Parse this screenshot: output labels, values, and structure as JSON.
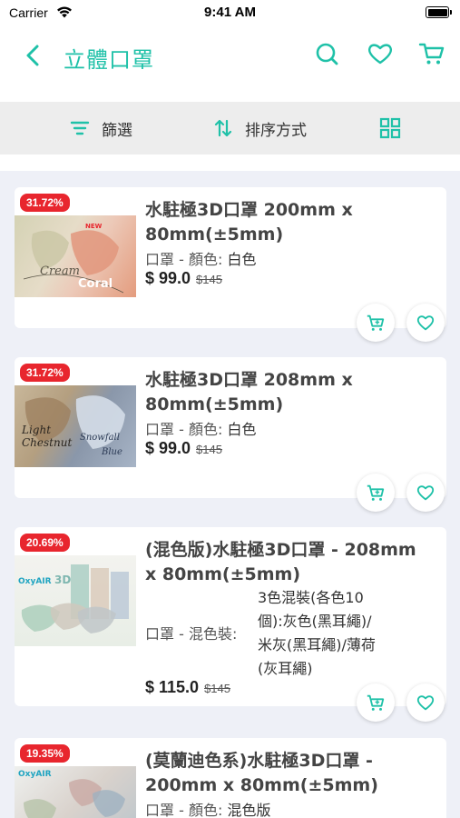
{
  "status_bar": {
    "carrier": "Carrier",
    "time": "9:41 AM"
  },
  "header": {
    "title": "立體口罩",
    "back_icon": "chevron-left-icon",
    "search_icon": "search-icon",
    "wishlist_icon": "heart-icon",
    "cart_icon": "cart-icon"
  },
  "toolbar": {
    "filter_label": "篩選",
    "sort_label": "排序方式",
    "grid_icon": "grid-view-icon"
  },
  "colors": {
    "accent": "#1fc1a8",
    "discount": "#e8262e",
    "list_bg": "#eef0f7",
    "toolbar_bg": "#ededed"
  },
  "products": [
    {
      "discount": "31.72%",
      "title_line1": "水駐極3D口罩 200mm x",
      "title_line2": "80mm(±5mm)",
      "meta_label": "口罩 - 顏色:",
      "meta_value": "白色",
      "price": "$ 99.0",
      "old_price": "$145",
      "image_text_1": "Cream",
      "image_text_2": "Coral",
      "image_text_3": "NEW"
    },
    {
      "discount": "31.72%",
      "title_line1": "水駐極3D口罩 208mm x",
      "title_line2": "80mm(±5mm)",
      "meta_label": "口罩 - 顏色:",
      "meta_value": "白色",
      "price": "$ 99.0",
      "old_price": "$145",
      "image_text_1": "Light",
      "image_text_2": "Chestnut",
      "image_text_3": "Snowfall",
      "image_text_4": "Blue"
    },
    {
      "discount": "20.69%",
      "title_line1": "(混色版)水駐極3D口罩 - 208mm",
      "title_line2": "x 80mm(±5mm)",
      "meta_label": "口罩 - 混色裝:",
      "meta_value_lines": [
        "3色混裝(各色10",
        "個):灰色(黑耳繩)/",
        "米灰(黑耳繩)/薄荷",
        "(灰耳繩)"
      ],
      "price": "$ 115.0",
      "old_price": "$145",
      "image_text_1": "OxyAIR",
      "image_text_2": "3D"
    },
    {
      "discount": "19.35%",
      "title_line1": "(莫蘭迪色系)水駐極3D口罩 -",
      "title_line2": "200mm x 80mm(±5mm)",
      "meta_label": "口罩 - 顏色:",
      "meta_value": "混色版",
      "image_text_1": "OxyAIR"
    }
  ]
}
